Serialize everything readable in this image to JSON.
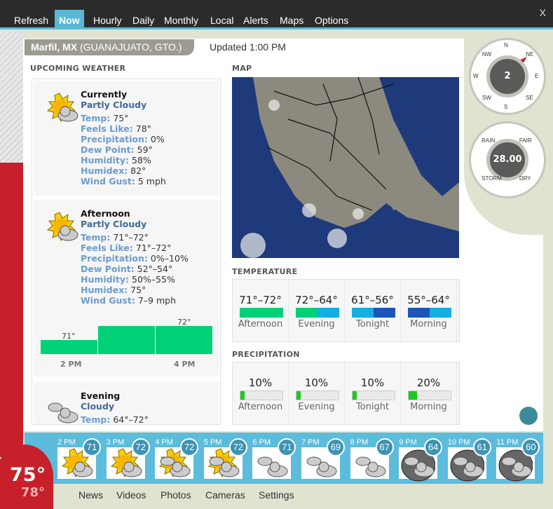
{
  "nav": {
    "tabs": [
      "Refresh",
      "Now",
      "Hourly",
      "Daily",
      "Monthly",
      "Local",
      "Alerts",
      "Maps",
      "Options"
    ],
    "active": "Now",
    "close": "X"
  },
  "location": {
    "city": "Marfil, MX",
    "region": "(GUANAJUATO, GTO.)",
    "updated": "Updated 1:00 PM"
  },
  "sections": {
    "upcoming": "UPCOMING WEATHER",
    "map": "MAP",
    "temperature": "TEMPERATURE",
    "precipitation": "PRECIPITATION"
  },
  "cards": [
    {
      "title": "Currently",
      "condition": "Partly Cloudy",
      "icon": "partly-cloudy-icon",
      "rows": [
        [
          "Temp:",
          "75°"
        ],
        [
          "Feels Like:",
          "78°"
        ],
        [
          "Precipitation:",
          "0%"
        ],
        [
          "Dew Point:",
          "59°"
        ],
        [
          "Humidity:",
          "58%"
        ],
        [
          "Humidex:",
          "82°"
        ],
        [
          "Wind Gust:",
          "5 mph"
        ]
      ]
    },
    {
      "title": "Afternoon",
      "condition": "Partly Cloudy",
      "icon": "partly-cloudy-icon",
      "rows": [
        [
          "Temp:",
          "71°–72°"
        ],
        [
          "Feels Like:",
          "71°–72°"
        ],
        [
          "Precipitation:",
          "0%–10%"
        ],
        [
          "Dew Point:",
          "52°–54°"
        ],
        [
          "Humidity:",
          "50%–55%"
        ],
        [
          "Humidex:",
          "75°"
        ],
        [
          "Wind Gust:",
          "7–9 mph"
        ]
      ]
    },
    {
      "title": "Evening",
      "condition": "Cloudy",
      "icon": "cloudy-icon",
      "rows": [
        [
          "Temp:",
          "64°–72°"
        ]
      ]
    }
  ],
  "afternoon_chart": {
    "labels": [
      "71°",
      "72°"
    ],
    "ticks": [
      "2 PM",
      "4 PM"
    ],
    "values": [
      71,
      72,
      72
    ],
    "color": "#00d078"
  },
  "temperature": [
    {
      "range": "71°–72°",
      "label": "Afternoon",
      "colors": [
        "#00d078",
        "#00d078"
      ]
    },
    {
      "range": "72°–64°",
      "label": "Evening",
      "colors": [
        "#00d078",
        "#14aee0"
      ]
    },
    {
      "range": "61°–56°",
      "label": "Tonight",
      "colors": [
        "#14aee0",
        "#1c56b8"
      ]
    },
    {
      "range": "55°–64°",
      "label": "Morning",
      "colors": [
        "#1c56b8",
        "#14aee0"
      ]
    }
  ],
  "precipitation": [
    {
      "value": "10%",
      "label": "Afternoon",
      "fraction": 0.1
    },
    {
      "value": "10%",
      "label": "Evening",
      "fraction": 0.1
    },
    {
      "value": "10%",
      "label": "Tonight",
      "fraction": 0.1
    },
    {
      "value": "20%",
      "label": "Morning",
      "fraction": 0.2
    }
  ],
  "wind": {
    "speed": "2",
    "direction": "NE",
    "dirs": [
      "N",
      "NE",
      "E",
      "SE",
      "S",
      "SW",
      "W",
      "NW"
    ]
  },
  "barometer": {
    "value": "28.00",
    "labels": [
      "RAIN",
      "FAIR",
      "STORM",
      "DRY"
    ]
  },
  "current": {
    "temp": "75°",
    "feels": "78°"
  },
  "hourly": [
    {
      "time": "2 PM",
      "temp": "71",
      "icon": "partly-cloudy-icon"
    },
    {
      "time": "3 PM",
      "temp": "72",
      "icon": "partly-cloudy-icon"
    },
    {
      "time": "4 PM",
      "temp": "72",
      "icon": "mostly-cloudy-icon"
    },
    {
      "time": "5 PM",
      "temp": "72",
      "icon": "mostly-cloudy-icon"
    },
    {
      "time": "6 PM",
      "temp": "71",
      "icon": "cloudy-icon"
    },
    {
      "time": "7 PM",
      "temp": "69",
      "icon": "cloudy-icon"
    },
    {
      "time": "8 PM",
      "temp": "67",
      "icon": "cloudy-icon"
    },
    {
      "time": "9 PM",
      "temp": "64",
      "icon": "cloudy-night-icon"
    },
    {
      "time": "10 PM",
      "temp": "61",
      "icon": "cloudy-night-icon"
    },
    {
      "time": "11 PM",
      "temp": "60",
      "icon": "cloudy-night-icon"
    }
  ],
  "footer": [
    "News",
    "Videos",
    "Photos",
    "Cameras",
    "Settings"
  ]
}
